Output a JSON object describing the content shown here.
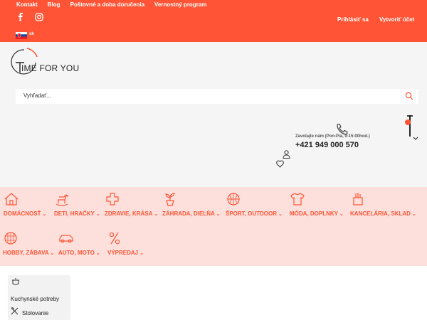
{
  "topbar": {
    "links": [
      "Kontakt",
      "Blog",
      "Poštovné a doba doručenia",
      "Vernostný program"
    ],
    "language": "sk",
    "login": "Prihlásiť sa",
    "register": "Vytvoriť účet"
  },
  "header": {
    "logo_text": "IME FOR YOU",
    "search_placeholder": "Vyhľadať...",
    "call_label": "Zavolajte nám (Pon-Pia, 9-15:00hod.)",
    "phone": "+421 949 000 570"
  },
  "categories": [
    {
      "label": "DOMÁCNOSŤ",
      "icon": "house-icon"
    },
    {
      "label": "DETI, HRAČKY",
      "icon": "rocking-horse-icon"
    },
    {
      "label": "ZDRAVIE, KRÁSA",
      "icon": "medical-cross-icon"
    },
    {
      "label": "ZÁHRADA, DIELŇA",
      "icon": "plant-icon"
    },
    {
      "label": "ŠPORT, OUTDOOR",
      "icon": "ball-icon"
    },
    {
      "label": "MÓDA, DOPLNKY",
      "icon": "tshirt-icon"
    },
    {
      "label": "KANCELÁRIA, SKLAD",
      "icon": "pencil-cup-icon"
    },
    {
      "label": "HOBBY, ZÁBAVA",
      "icon": "disco-ball-icon"
    },
    {
      "label": "AUTO, MOTO",
      "icon": "car-icon"
    },
    {
      "label": "VÝPREDAJ",
      "icon": "percent-icon"
    }
  ],
  "dropdown": {
    "items": [
      "Kuchynské potreby",
      "Stolovanie"
    ]
  },
  "colors": {
    "accent": "#ff5536",
    "category_band": "#fde0dc",
    "header_bg": "#f5f5f5"
  }
}
